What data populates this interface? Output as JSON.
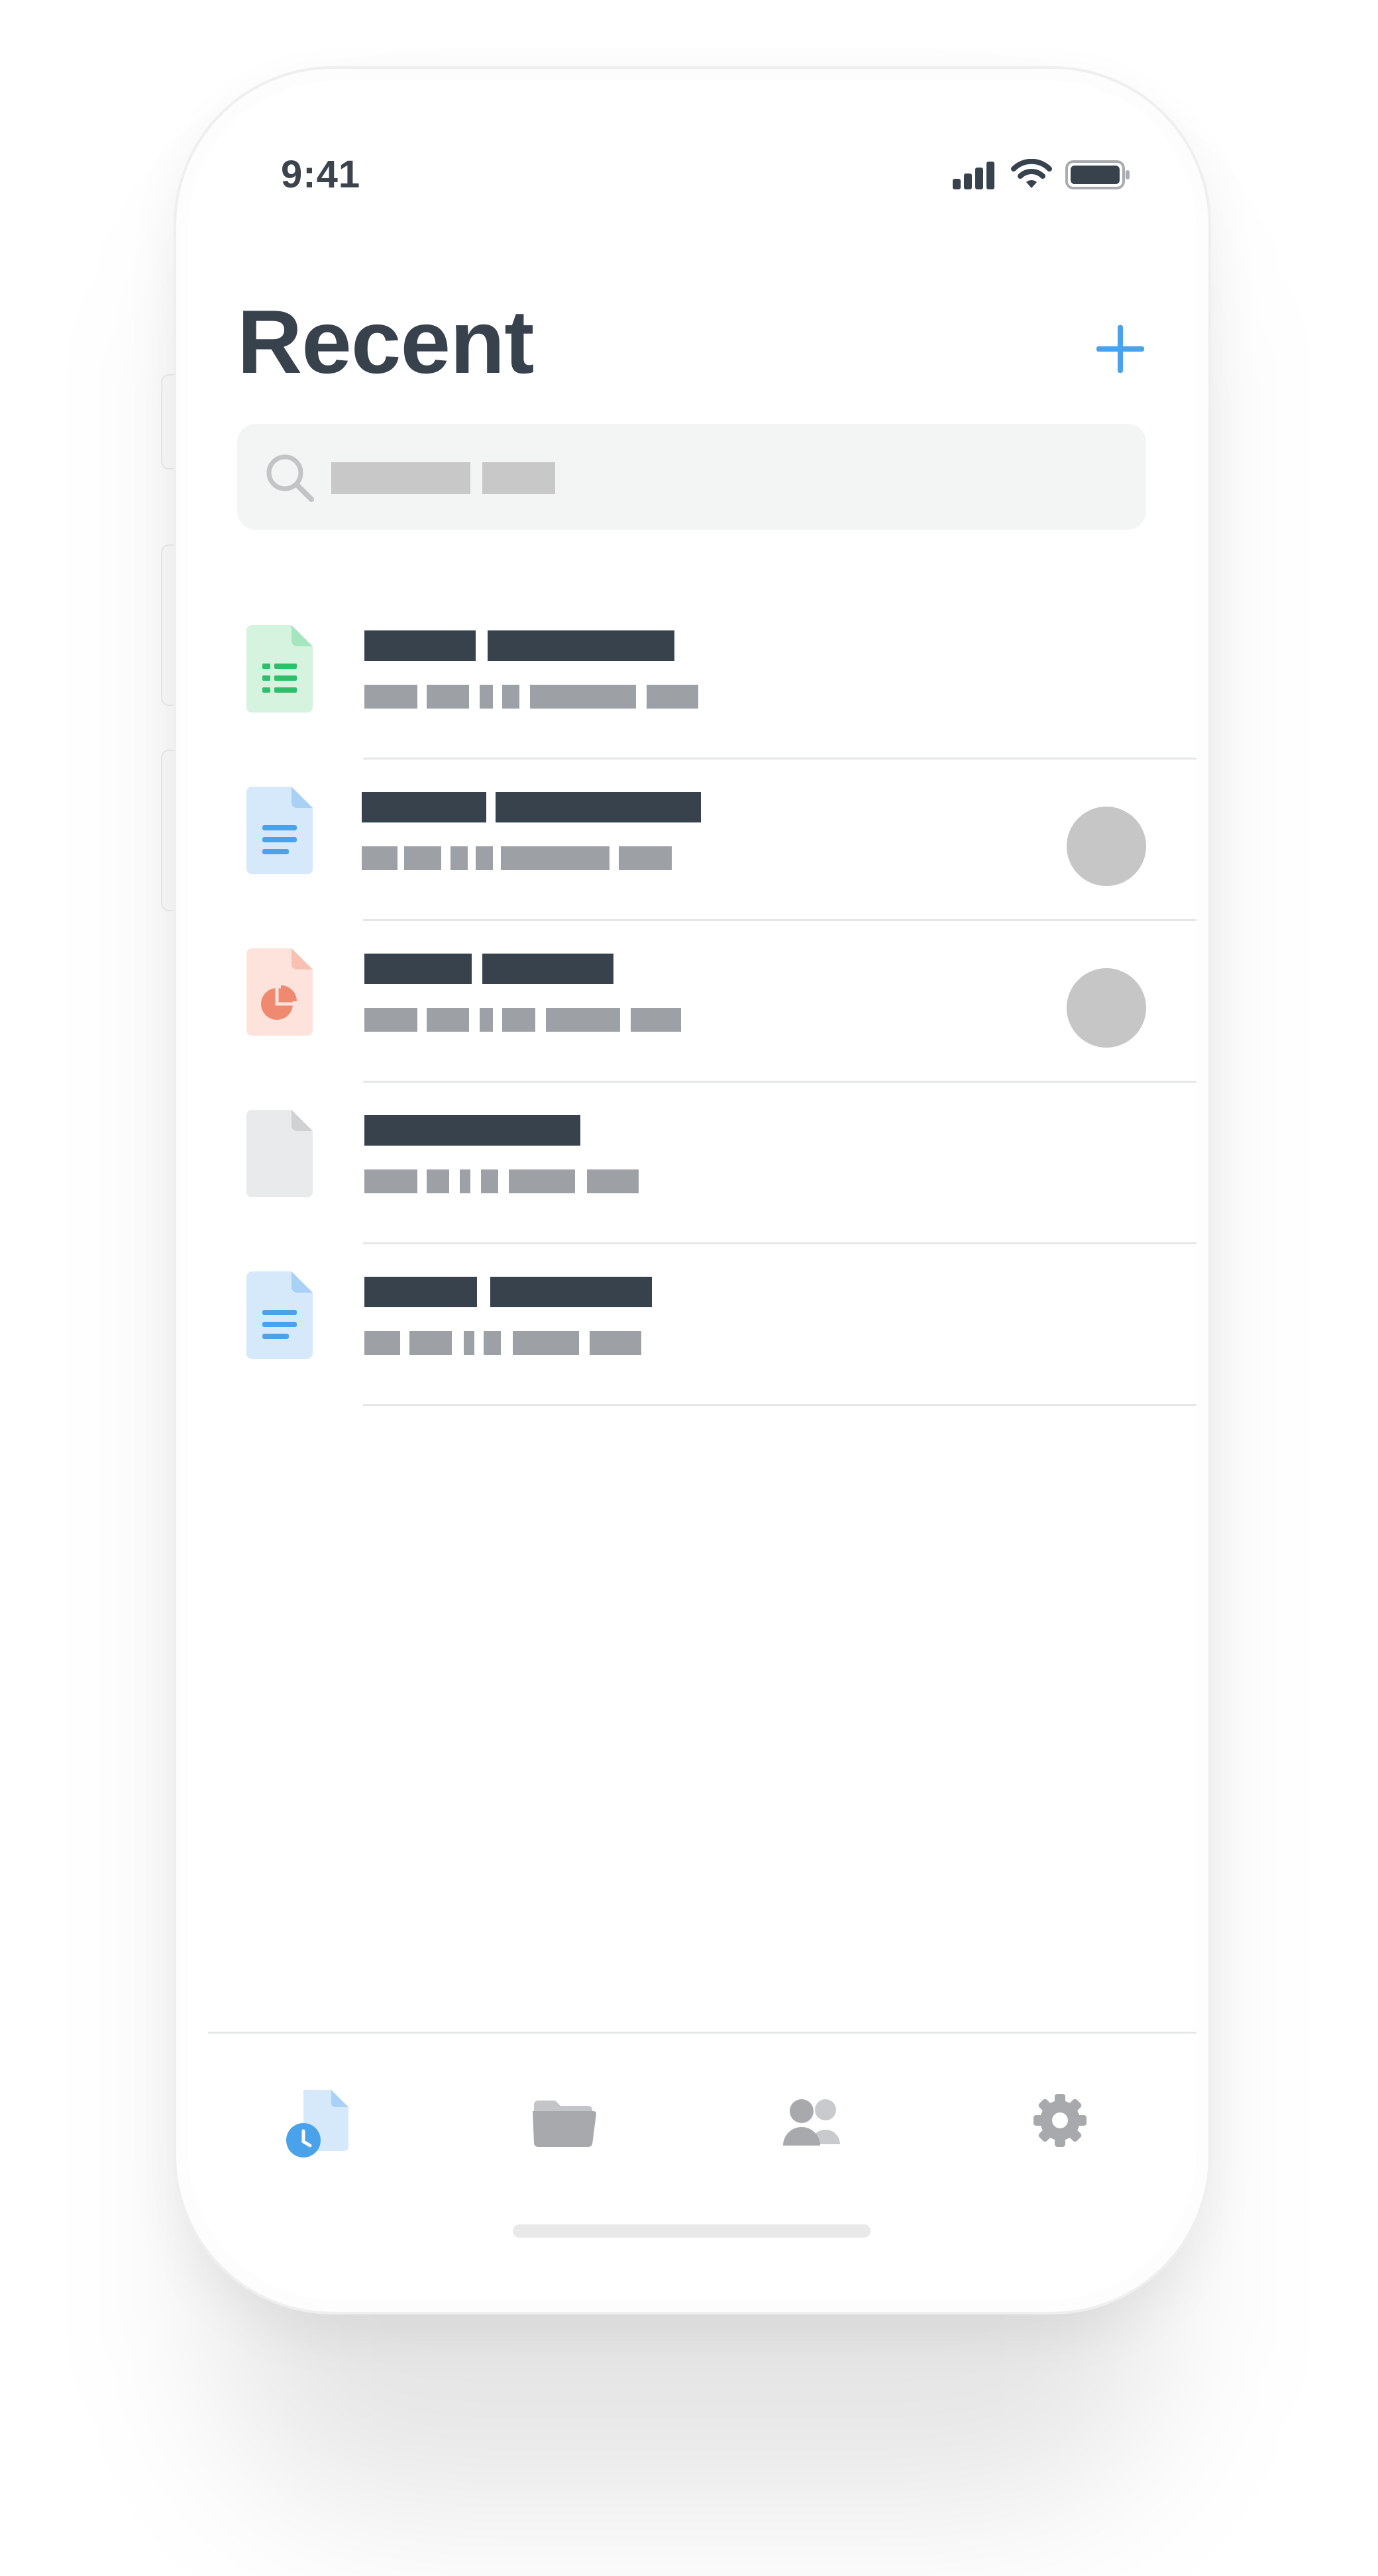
{
  "status_bar": {
    "time": "9:41",
    "icons": [
      "cellular-signal-icon",
      "wifi-icon",
      "battery-icon"
    ]
  },
  "header": {
    "title": "Recent",
    "add_icon": "plus-icon"
  },
  "search": {
    "icon": "search-icon"
  },
  "files": [
    {
      "type": "spreadsheet",
      "icon": "spreadsheet-file-icon",
      "shared": false
    },
    {
      "type": "document",
      "icon": "document-file-icon",
      "shared": true
    },
    {
      "type": "presentation",
      "icon": "presentation-file-icon",
      "shared": true
    },
    {
      "type": "generic",
      "icon": "generic-file-icon",
      "shared": false
    },
    {
      "type": "document",
      "icon": "document-file-icon",
      "shared": false
    }
  ],
  "tab_bar": {
    "tabs": [
      {
        "id": "recent",
        "icon": "recent-files-icon",
        "active": true
      },
      {
        "id": "files",
        "icon": "folder-icon",
        "active": false
      },
      {
        "id": "shared",
        "icon": "people-icon",
        "active": false
      },
      {
        "id": "settings",
        "icon": "gear-icon",
        "active": false
      }
    ]
  },
  "colors": {
    "accent": "#4aa3ea",
    "title_text": "#38424c",
    "secondary_text": "#9da1a6",
    "spreadsheet": "#2fbf6a",
    "presentation": "#ef8a70",
    "inactive_icon": "#a7a9ac"
  }
}
